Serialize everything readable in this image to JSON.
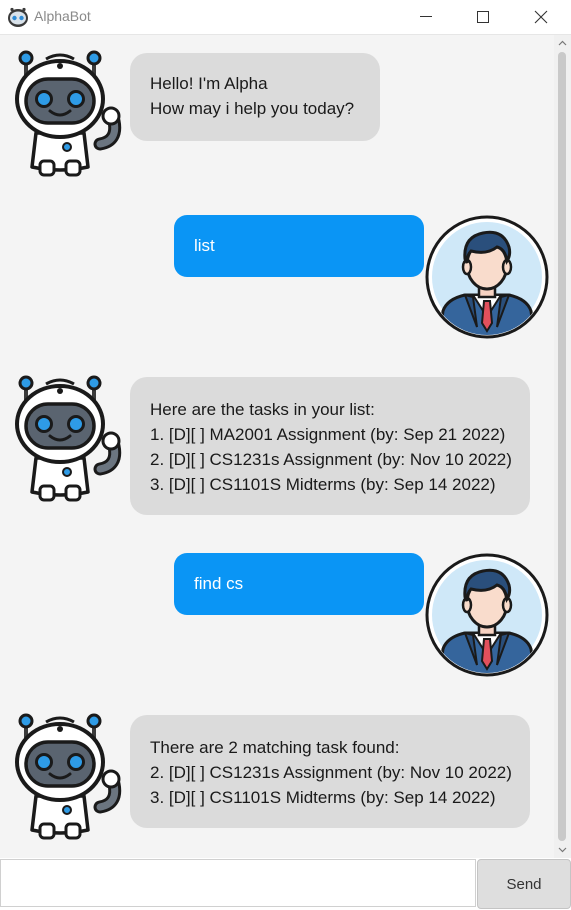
{
  "window": {
    "title": "AlphaBot"
  },
  "messages": [
    {
      "sender": "bot",
      "lines": [
        "Hello! I'm Alpha",
        "How may i help you today?"
      ]
    },
    {
      "sender": "user",
      "lines": [
        "list"
      ]
    },
    {
      "sender": "bot",
      "lines": [
        "Here are the tasks in your list:",
        "1. [D][ ] MA2001 Assignment (by: Sep 21 2022)",
        "2. [D][ ] CS1231s Assignment (by: Nov 10 2022)",
        "3. [D][ ] CS1101S Midterms (by: Sep 14 2022)"
      ]
    },
    {
      "sender": "user",
      "lines": [
        "find cs"
      ]
    },
    {
      "sender": "bot",
      "lines": [
        "There are 2 matching task found:",
        "2. [D][ ] CS1231s Assignment (by: Nov 10 2022)",
        "3. [D][ ] CS1101S Midterms (by: Sep 14 2022)"
      ]
    }
  ],
  "input": {
    "value": "",
    "placeholder": ""
  },
  "send_button": {
    "label": "Send"
  },
  "colors": {
    "bot_bubble": "#dbdbdb",
    "user_bubble": "#0a95f5",
    "chat_background": "#f4f4f4"
  },
  "icons": {
    "bot_avatar": "robot-icon",
    "user_avatar": "businessman-icon"
  }
}
